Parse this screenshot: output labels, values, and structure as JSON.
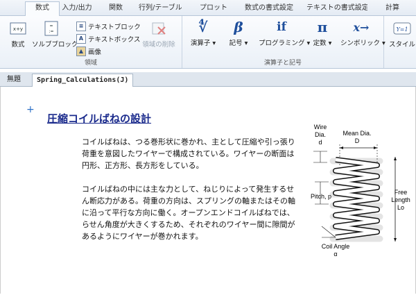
{
  "tabs": [
    {
      "label": "数式",
      "active": true
    },
    {
      "label": "入力/出力"
    },
    {
      "label": "関数"
    },
    {
      "label": "行列/テーブル"
    },
    {
      "label": "プロット"
    },
    {
      "label": "数式の書式設定"
    },
    {
      "label": "テキストの書式設定"
    },
    {
      "label": "計算"
    }
  ],
  "ribbon": {
    "region_group_label": "領域",
    "math_button": "数式",
    "solve_block_button": "ソルブブロック",
    "text_block": "テキストブロック",
    "text_box": "テキストボックス",
    "image": "画像",
    "delete_region": "領域の削除",
    "operators_group_label": "演算子と記号",
    "operators": "演算子",
    "symbols": "記号",
    "programming": "プログラミング",
    "constants": "定数",
    "symbolics": "シンボリック",
    "style": "スタイル"
  },
  "doc_tabs": [
    "無題",
    "Spring_Calculations(J)"
  ],
  "document": {
    "title": "圧縮コイルばねの設計",
    "para1": "コイルばねは、つる巻形状に巻かれ、主として圧縮や引っ張り荷重を意図したワイヤーで構成されている。ワイヤーの断面は円形、正方形、長方形をしている。",
    "para2": "コイルばねの中には主な力として、ねじりによって発生するせん断応力がある。荷重の方向は、スプリングの軸またはその軸に沿って平行な方向に働く。オープンエンドコイルばねでは、らせん角度が大きくするため、それぞれのワイヤー間に隙間があるようにワイヤーが巻かれます。"
  },
  "diagram": {
    "wire_dia": [
      "Wire",
      "Dia.",
      "d"
    ],
    "mean_dia": [
      "Mean Dia.",
      "D"
    ],
    "pitch": "Pitch, p",
    "free_length": [
      "Free",
      "Length",
      "Lo"
    ],
    "coil_angle": [
      "Coil Angle",
      "α"
    ]
  }
}
